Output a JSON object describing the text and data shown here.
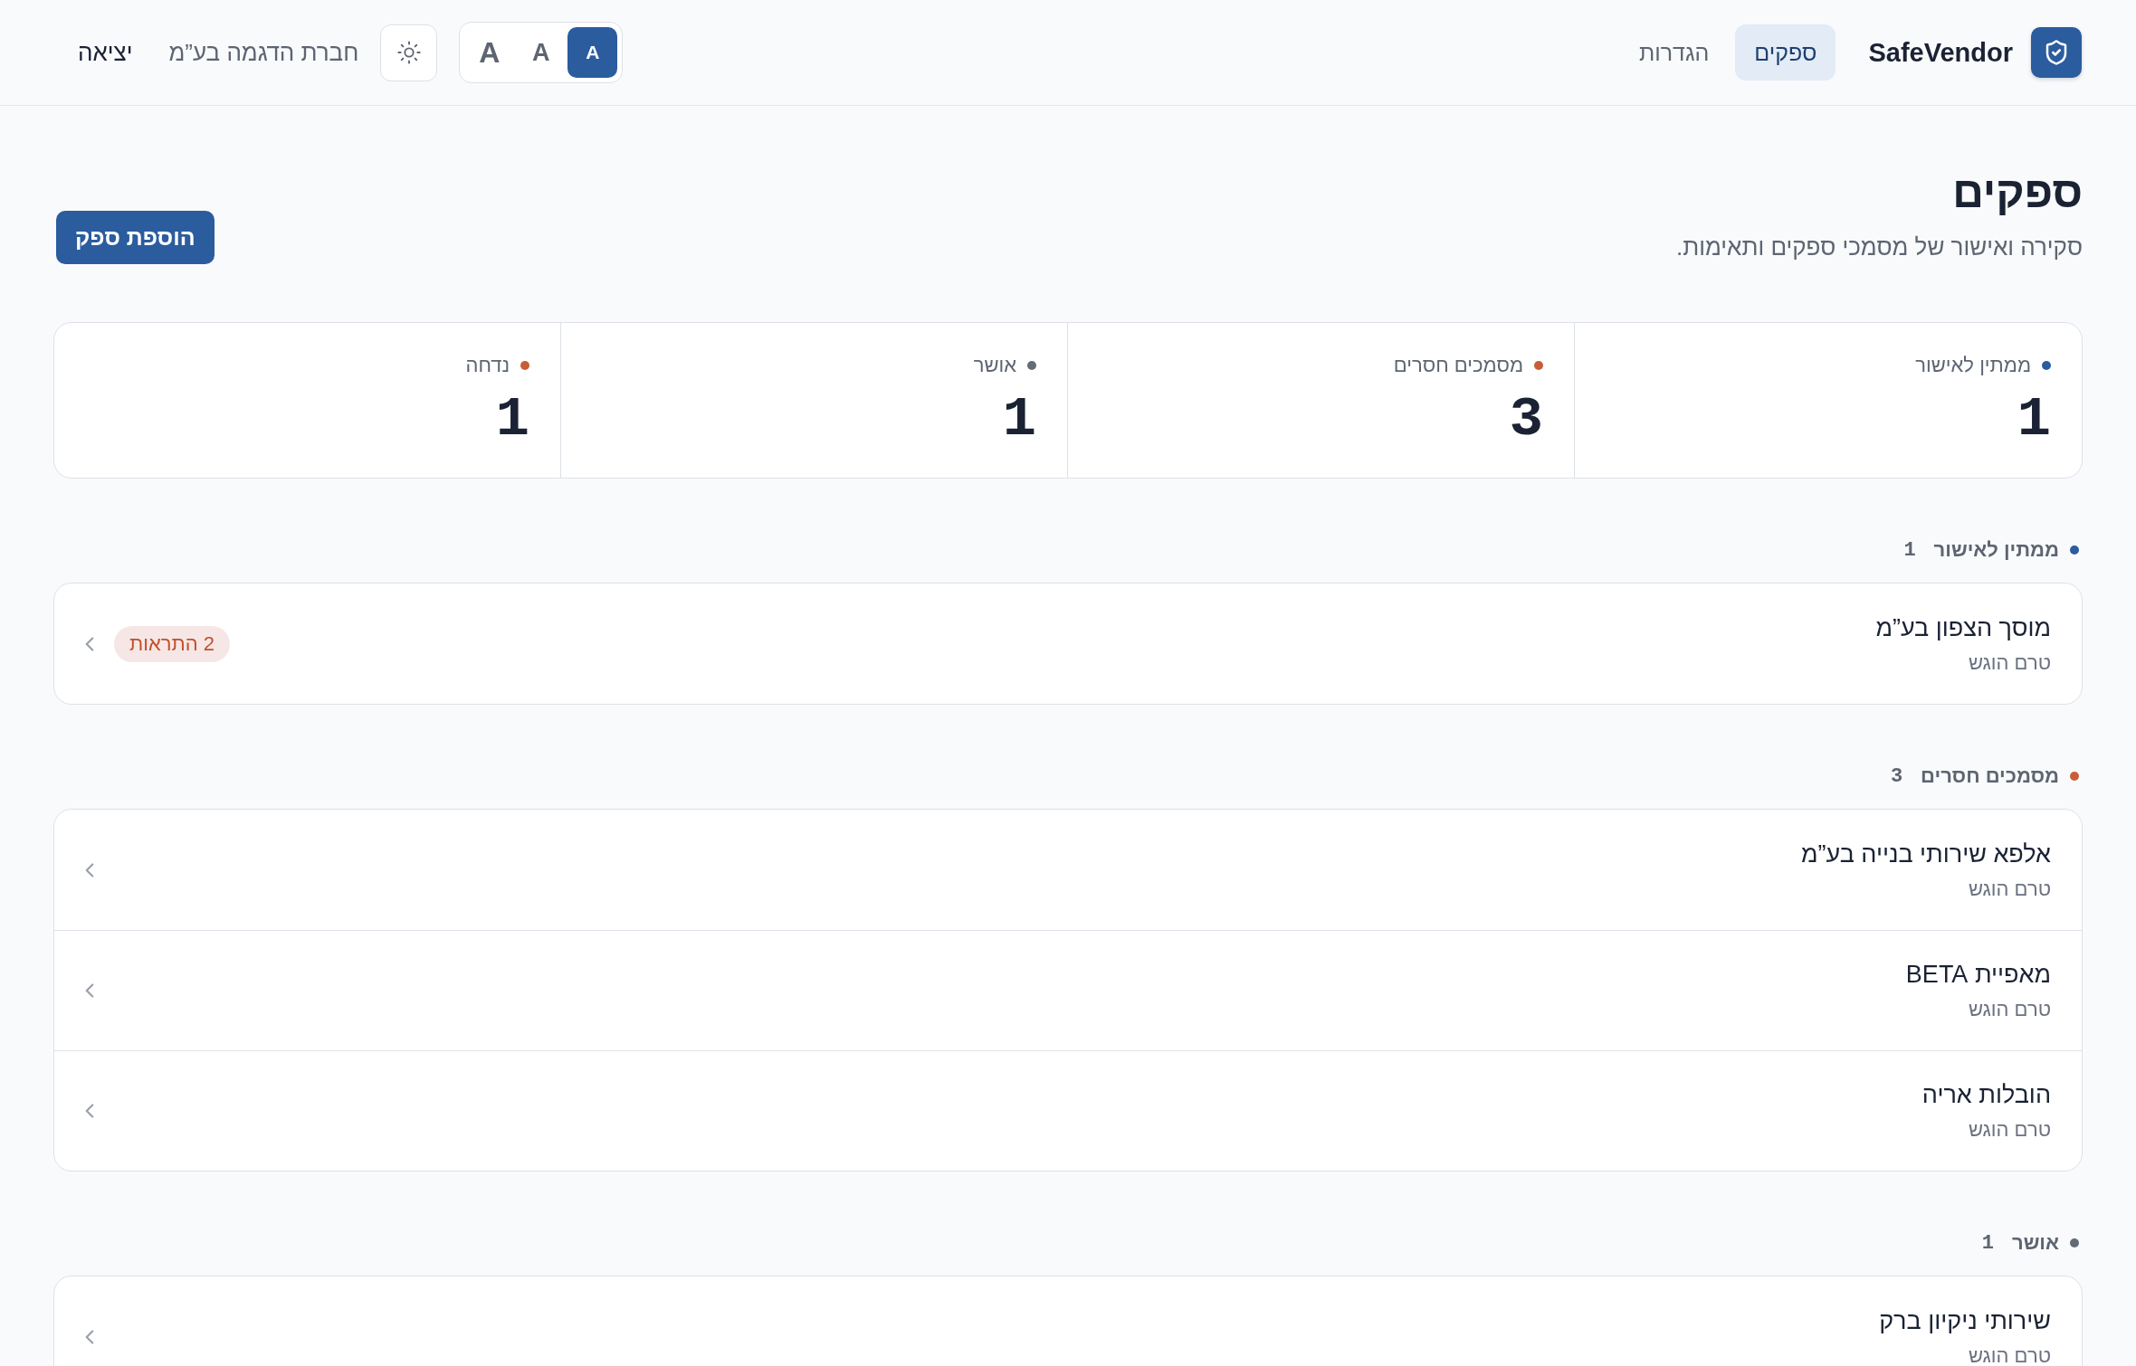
{
  "header": {
    "brand": "SafeVendor",
    "nav": [
      {
        "label": "ספקים",
        "selected": true
      },
      {
        "label": "הגדרות",
        "selected": false
      }
    ],
    "font_sizes": [
      {
        "label": "A",
        "kind": "small",
        "selected": true
      },
      {
        "label": "A",
        "kind": "medium",
        "selected": false
      },
      {
        "label": "A",
        "kind": "large",
        "selected": false
      }
    ],
    "company": "חברת הדגמה בע”מ",
    "logout": "יציאה"
  },
  "page": {
    "title": "ספקים",
    "subtitle": "סקירה ואישור של מסמכי ספקים ותאימות.",
    "add_button": "הוספת ספק"
  },
  "stats": [
    {
      "label": "ממתין לאישור",
      "value": "1",
      "color": "#2b5c9e"
    },
    {
      "label": "מסמכים חסרים",
      "value": "3",
      "color": "#c85d37"
    },
    {
      "label": "אושר",
      "value": "1",
      "color": "#646b75"
    },
    {
      "label": "נדחה",
      "value": "1",
      "color": "#c85d37"
    }
  ],
  "groups": [
    {
      "title": "ממתין לאישור",
      "count": "1",
      "color": "#2b5c9e",
      "vendors": [
        {
          "name": "מוסך הצפון בע”מ",
          "status": "טרם הוגש",
          "alerts": "2 התראות"
        }
      ]
    },
    {
      "title": "מסמכים חסרים",
      "count": "3",
      "color": "#c85d37",
      "vendors": [
        {
          "name": "אלפא שירותי בנייה בע”מ",
          "status": "טרם הוגש"
        },
        {
          "name": "מאפיית BETA",
          "status": "טרם הוגש"
        },
        {
          "name": "הובלות אריה",
          "status": "טרם הוגש"
        }
      ]
    },
    {
      "title": "אושר",
      "count": "1",
      "color": "#646b75",
      "vendors": [
        {
          "name": "שירותי ניקיון ברק",
          "status": "טרם הוגש"
        }
      ]
    }
  ]
}
